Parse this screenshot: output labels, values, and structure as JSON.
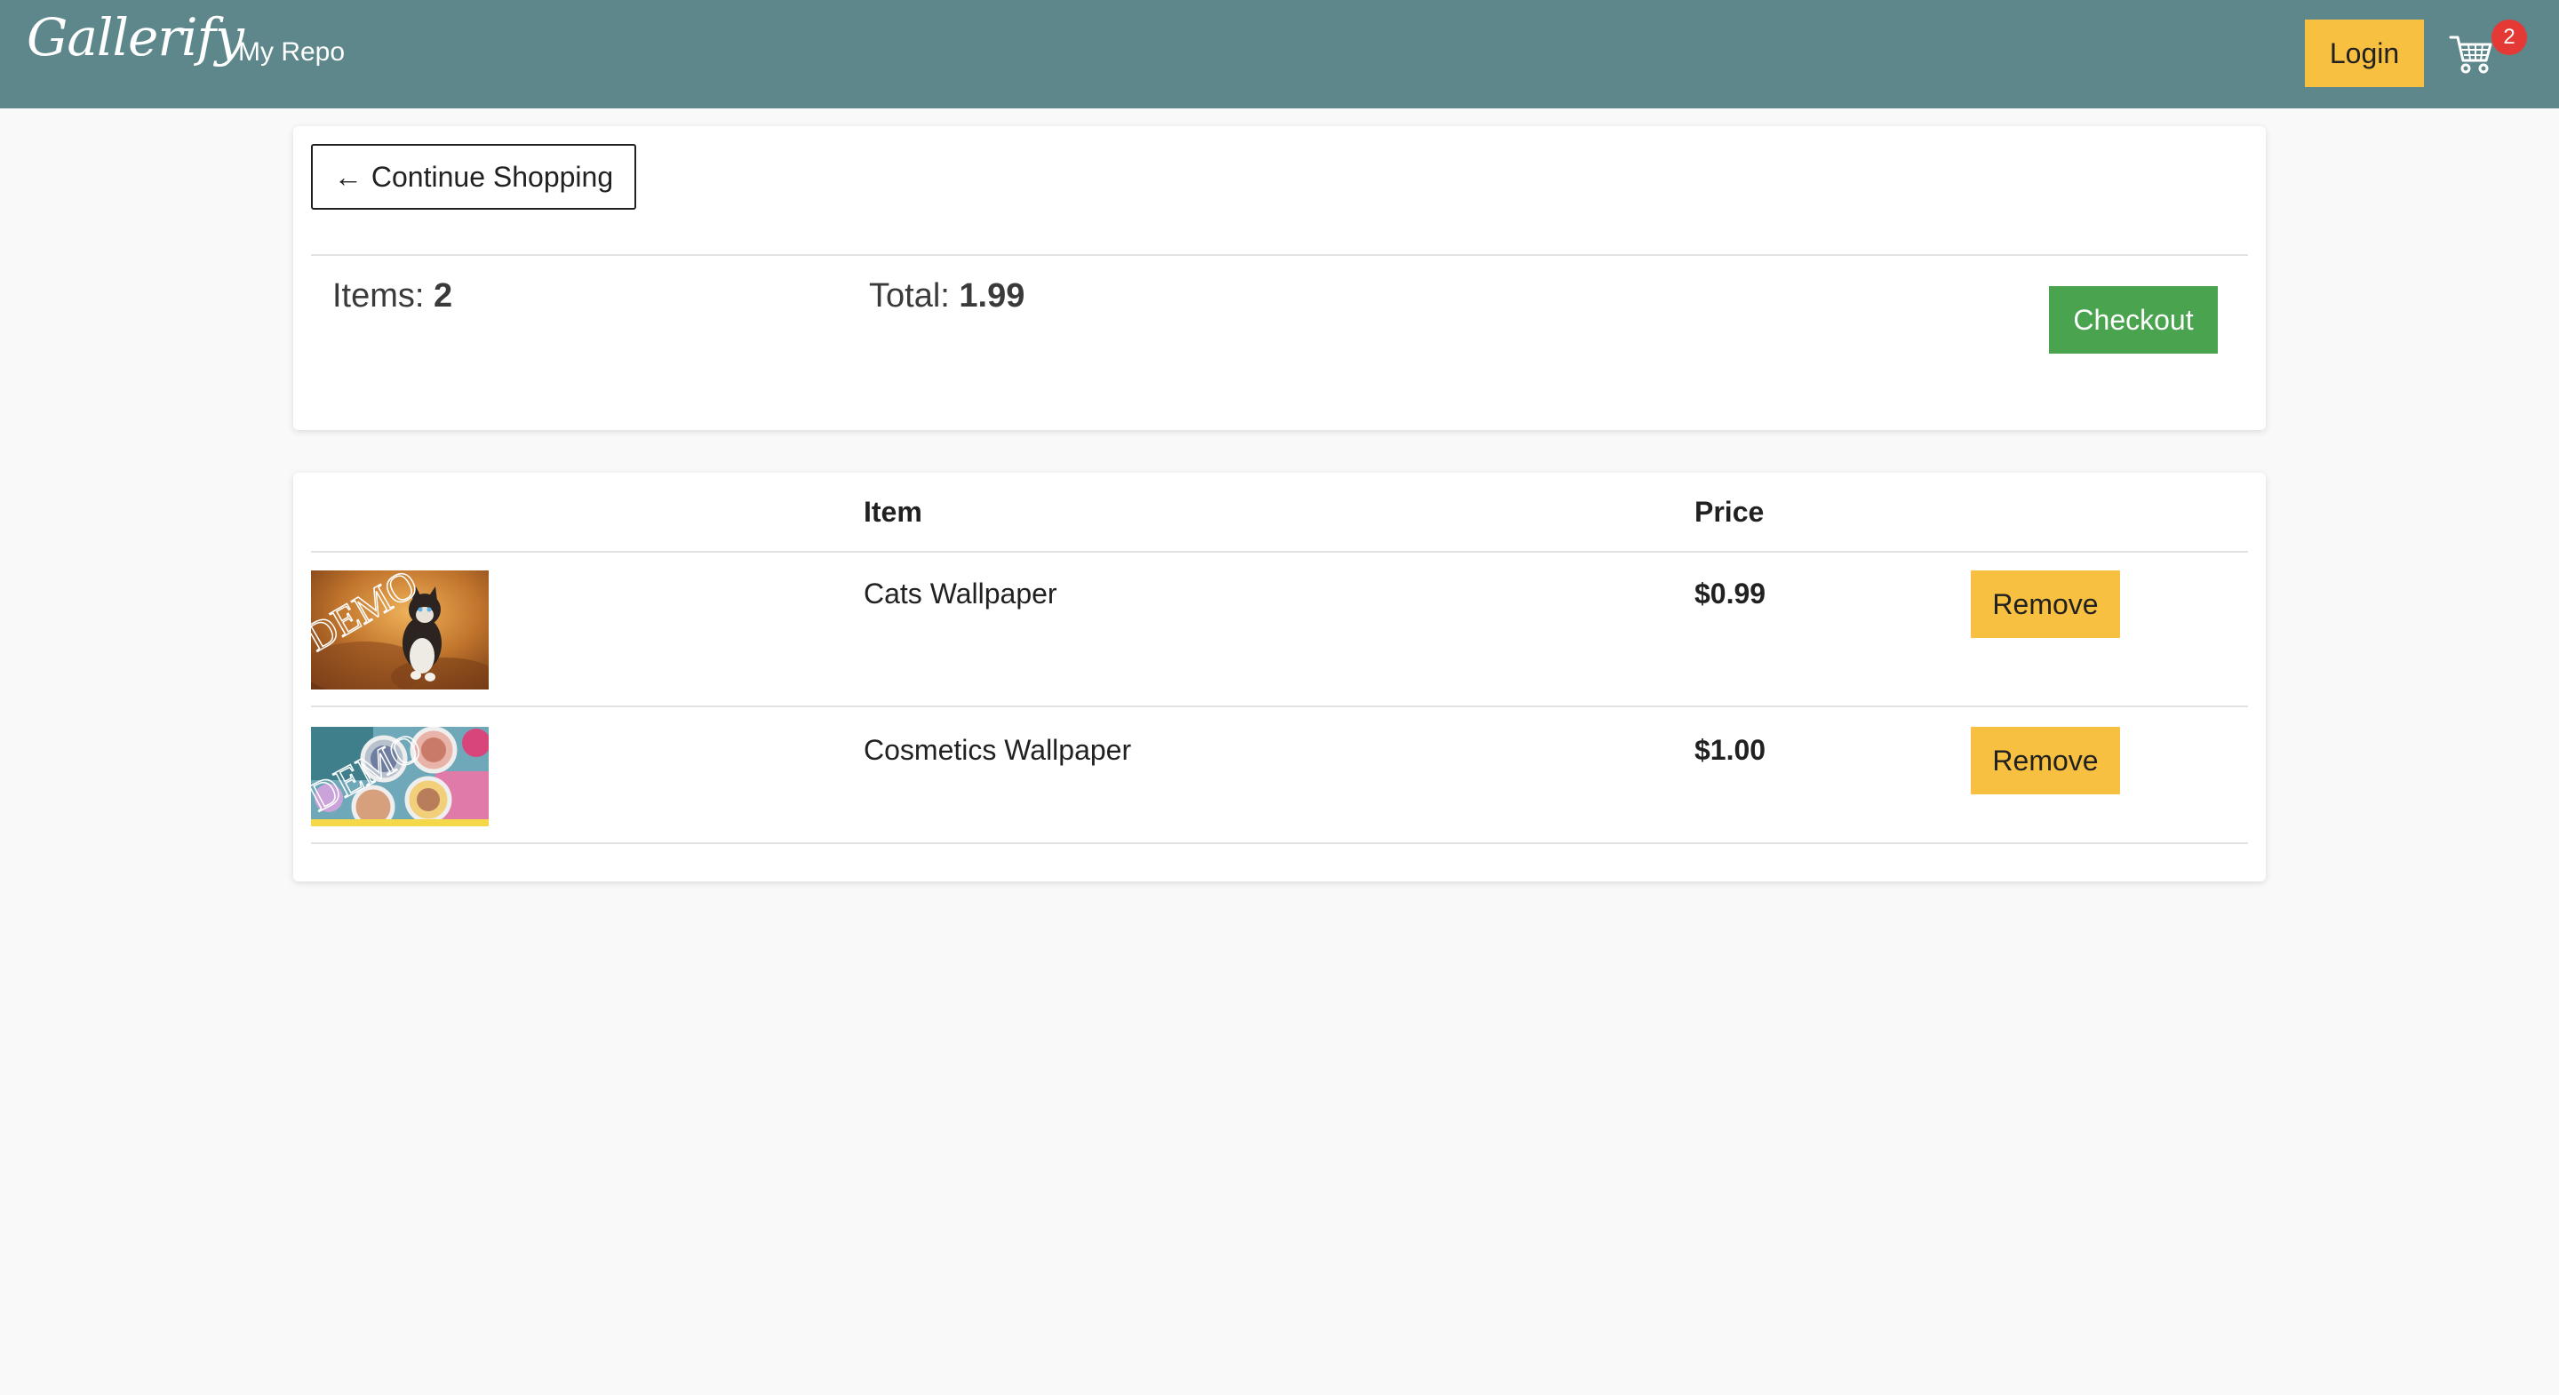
{
  "header": {
    "brand": "Gallerify",
    "nav_link": "My Repo",
    "login_label": "Login",
    "cart_count": "2",
    "cart_icon": "shopping-cart-icon"
  },
  "summary": {
    "continue_label": "Continue Shopping",
    "continue_icon": "arrow-left-icon",
    "items_label": "Items: ",
    "items_value": "2",
    "total_label": "Total: ",
    "total_value": "1.99",
    "checkout_label": "Checkout"
  },
  "table": {
    "columns": [
      "",
      "Item",
      "Price",
      ""
    ],
    "rows": [
      {
        "name": "Cats Wallpaper",
        "price": "$0.99",
        "action": "Remove",
        "thumbnail_watermark": "DEMO"
      },
      {
        "name": "Cosmetics Wallpaper",
        "price": "$1.00",
        "action": "Remove",
        "thumbnail_watermark": "DEMO"
      }
    ]
  },
  "colors": {
    "navbar": "#5d878b",
    "accent_yellow": "#f7c040",
    "checkout_green": "#4aa34f",
    "badge_red": "#e53935",
    "page_bg": "#f9f9f9"
  }
}
